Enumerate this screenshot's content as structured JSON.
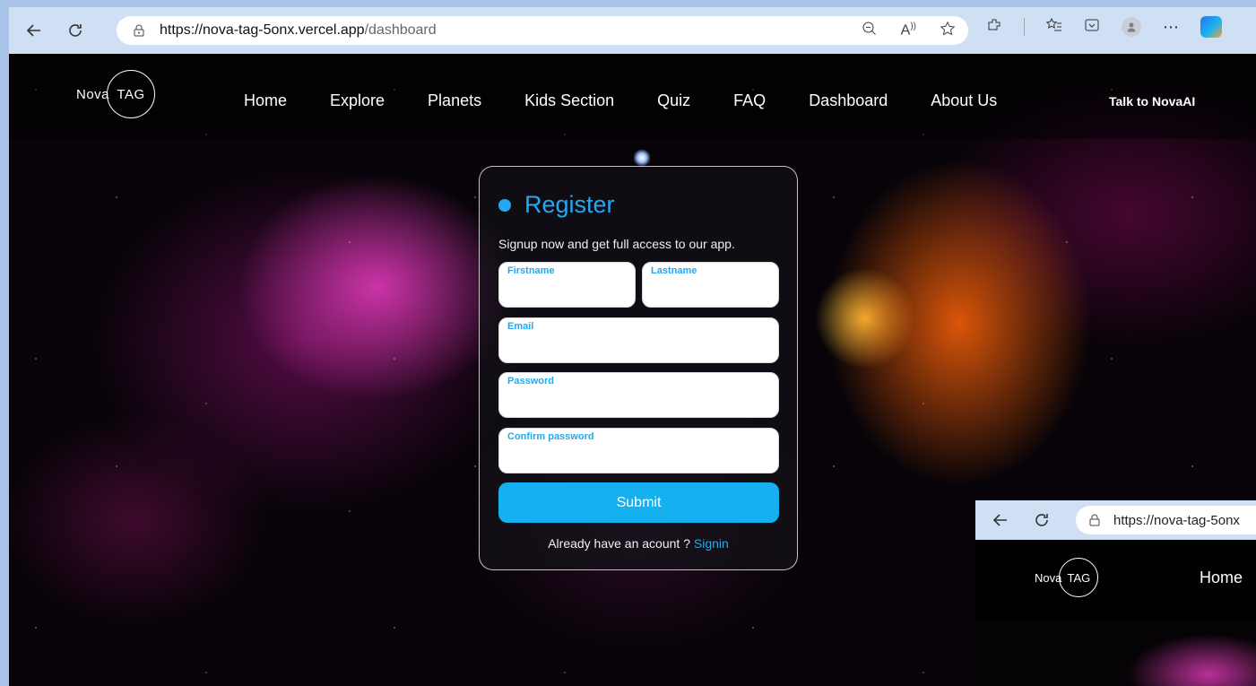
{
  "browser": {
    "url_host": "https://nova-tag-5onx.vercel.app",
    "url_path": "/dashboard",
    "icons": [
      "back-icon",
      "refresh-icon",
      "lock-icon",
      "zoom-out-icon",
      "read-aloud-icon",
      "favorite-star-icon",
      "extensions-icon",
      "favorites-icon",
      "collections-icon",
      "profile-icon",
      "more-icon",
      "copilot-icon"
    ]
  },
  "nav": {
    "logo_left": "Nova",
    "logo_right": "TAG",
    "links": [
      "Home",
      "Explore",
      "Planets",
      "Kids Section",
      "Quiz",
      "FAQ",
      "Dashboard",
      "About Us"
    ],
    "talk": "Talk to NovaAI"
  },
  "register": {
    "title": "Register",
    "subtitle": "Signup now and get full access to our app.",
    "fields": {
      "firstname": "Firstname",
      "lastname": "Lastname",
      "email": "Email",
      "password": "Password",
      "confirm": "Confirm password"
    },
    "submit": "Submit",
    "signin_prompt": "Already have an acount ? ",
    "signin_link": "Signin"
  },
  "inset": {
    "url": "https://nova-tag-5onx",
    "logo_left": "Nova",
    "logo_right": "TAG",
    "home": "Home"
  },
  "colors": {
    "accent": "#22a9f1",
    "submit_bg": "#14b0ef",
    "chrome_bg": "#cfe0f5"
  }
}
